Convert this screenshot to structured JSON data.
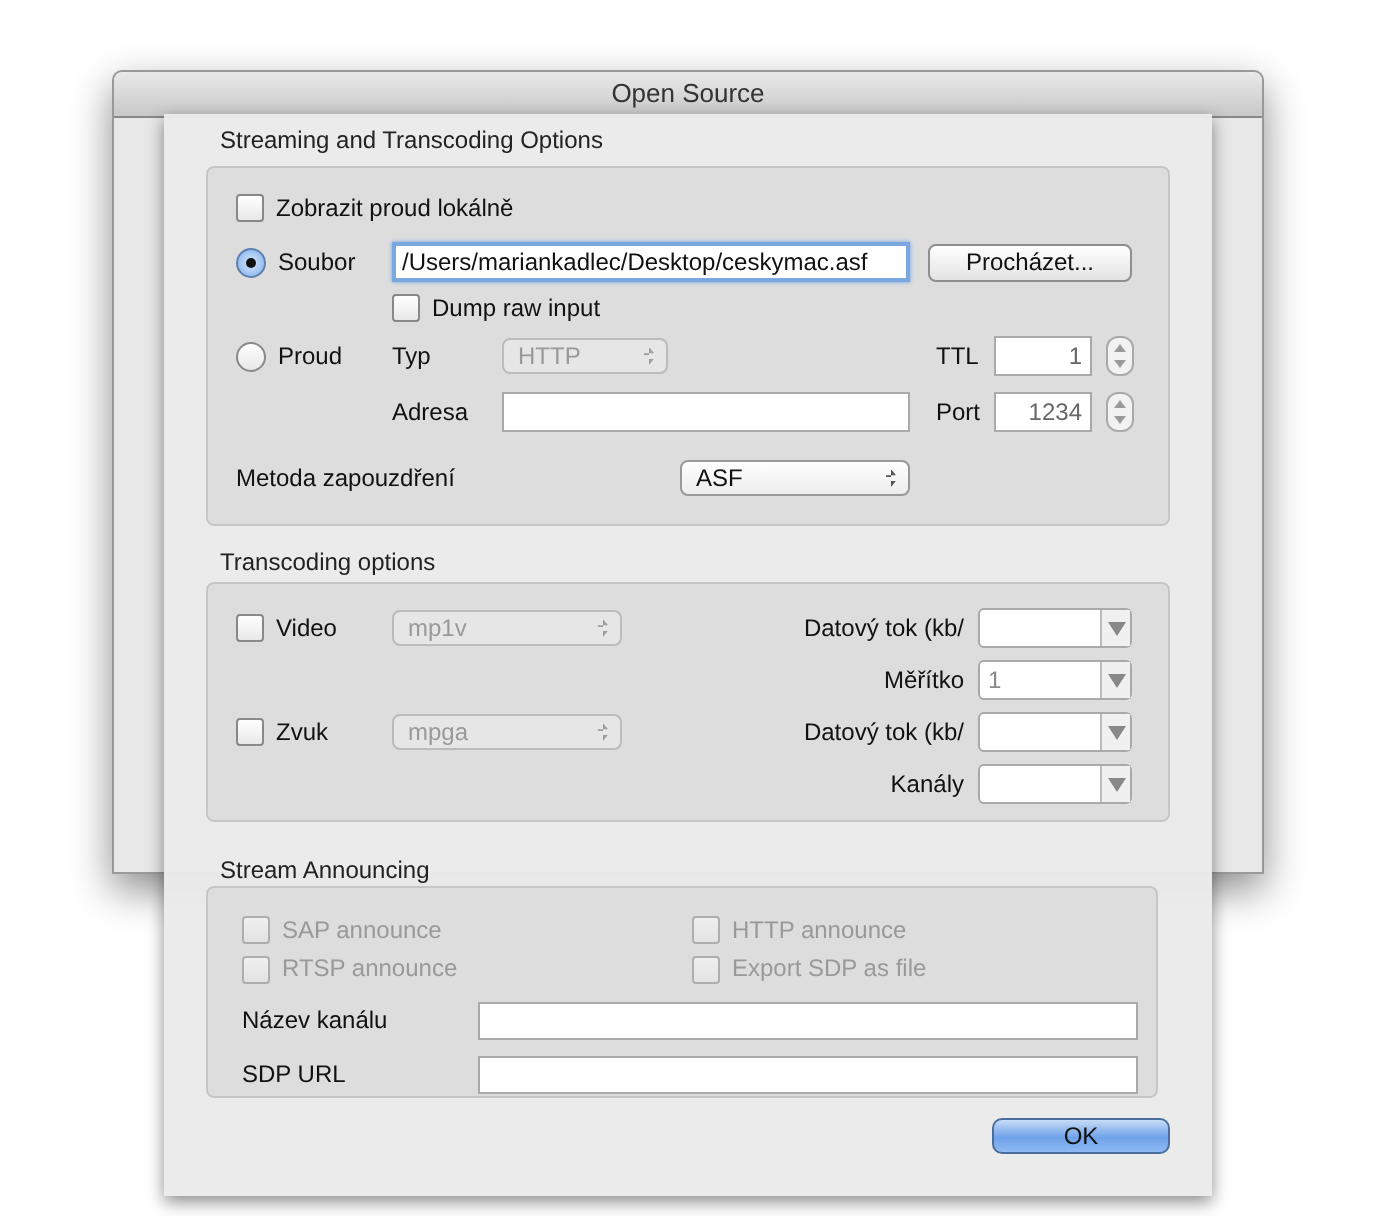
{
  "window": {
    "title": "Open Source"
  },
  "sheet": {
    "streaming": {
      "title": "Streaming and Transcoding Options",
      "display_locally": {
        "label": "Zobrazit proud lokálně",
        "checked": false
      },
      "sources": [
        {
          "label": "Soubor",
          "selected": true
        },
        {
          "label": "Proud",
          "selected": false
        }
      ],
      "file_path": {
        "value": "/Users/mariankadlec/Desktop/ceskymac.asf"
      },
      "browse_button": "Procházet...",
      "dump_raw": {
        "label": "Dump raw input",
        "checked": false
      },
      "type": {
        "label": "Typ",
        "value": "HTTP",
        "disabled": true
      },
      "ttl": {
        "label": "TTL",
        "value": "1",
        "disabled": true
      },
      "address": {
        "label": "Adresa"
      },
      "port": {
        "label": "Port",
        "value": "1234",
        "disabled": true
      },
      "encapsulation": {
        "label": "Metoda zapouzdření",
        "value": "ASF",
        "disabled": false
      }
    },
    "transcoding": {
      "title": "Transcoding options",
      "video": {
        "label": "Video",
        "checked": false,
        "codec": "mp1v",
        "disabled": true
      },
      "audio": {
        "label": "Zvuk",
        "checked": false,
        "codec": "mpga",
        "disabled": true
      },
      "fields": [
        {
          "label": "Datový tok (kb/"
        },
        {
          "label": "Měřítko",
          "value": "1"
        },
        {
          "label": "Datový tok (kb/"
        },
        {
          "label": "Kanály"
        }
      ]
    },
    "announcing": {
      "title": "Stream Announcing",
      "options": [
        {
          "label": "SAP announce",
          "checked": false,
          "disabled": true
        },
        {
          "label": "HTTP announce",
          "checked": false,
          "disabled": true
        },
        {
          "label": "RTSP announce",
          "checked": false,
          "disabled": true
        },
        {
          "label": "Export SDP as file",
          "checked": false,
          "disabled": true
        }
      ],
      "inputs": [
        {
          "label": "Název kanálu"
        },
        {
          "label": "SDP URL"
        }
      ]
    },
    "ok_button": "OK"
  }
}
